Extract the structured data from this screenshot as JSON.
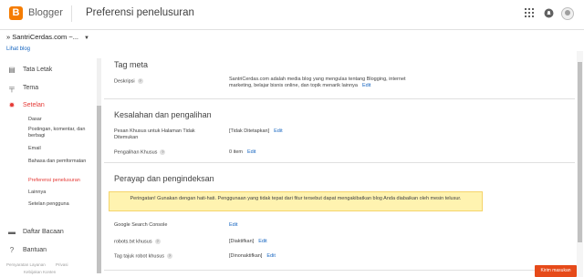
{
  "header": {
    "brand": "Blogger",
    "title": "Preferensi penelusuran",
    "icons": [
      "apps-icon",
      "notifications-icon",
      "account-avatar"
    ]
  },
  "blog_selector": {
    "name": "» SantriCerdas.com ~...",
    "view_link": "Lihat blog"
  },
  "sidebar": {
    "items": [
      {
        "label": "Tata Letak",
        "icon": "layout-icon"
      },
      {
        "label": "Tema",
        "icon": "paint-roller-icon"
      },
      {
        "label": "Setelan",
        "icon": "gear-icon"
      }
    ],
    "sub_items": [
      "Dasar",
      "Postingan, komentar, dan berbagi",
      "Email",
      "Bahasa dan pemformatan",
      "Preferensi penelusuran",
      "Lainnya",
      "Setelan pengguna"
    ],
    "bottom_items": [
      {
        "label": "Daftar Bacaan",
        "icon": "reading-list-icon"
      },
      {
        "label": "Bantuan",
        "icon": "help-icon"
      }
    ],
    "footer": {
      "privacy": "Persyaratan Layanan",
      "privacy2": "Privasi",
      "content": "Kebijakan Konten"
    }
  },
  "main": {
    "meta": {
      "title": "Tag meta",
      "desc_label": "Deskripsi",
      "desc_value": "SantriCerdas.com adalah media blog yang mengulas tentang Blogging, internet marketing, belajar bisnis online, dan topik menarik lainnya",
      "edit": "Edit"
    },
    "errors": {
      "title": "Kesalahan dan pengalihan",
      "notfound_label": "Pesan Khusus untuk Halaman Tidak Ditemukan",
      "notfound_value": "[Tidak Ditetapkan]",
      "redirect_label": "Pengalihan Khusus",
      "redirect_value": "0 item",
      "edit": "Edit"
    },
    "crawl": {
      "title": "Perayap dan pengindeksan",
      "warning": "Peringatan! Gunakan dengan hati-hati. Penggunaan yang tidak tepat dari fitur tersebut dapat mengakibatkan blog Anda diabaikan oleh mesin telusur.",
      "gsc_label": "Google Search Console",
      "robots_label": "robots.txt khusus",
      "robots_value": "[Diaktifkan]",
      "tags_label": "Tag tajuk robot khusus",
      "tags_value": "[Dinonaktifkan]",
      "edit": "Edit"
    }
  },
  "feedback_label": "Kirim masukan",
  "colors": {
    "accent": "#e53935",
    "brand": "#f57c00",
    "link": "#1565c0",
    "warning_bg": "#fff3b0"
  }
}
